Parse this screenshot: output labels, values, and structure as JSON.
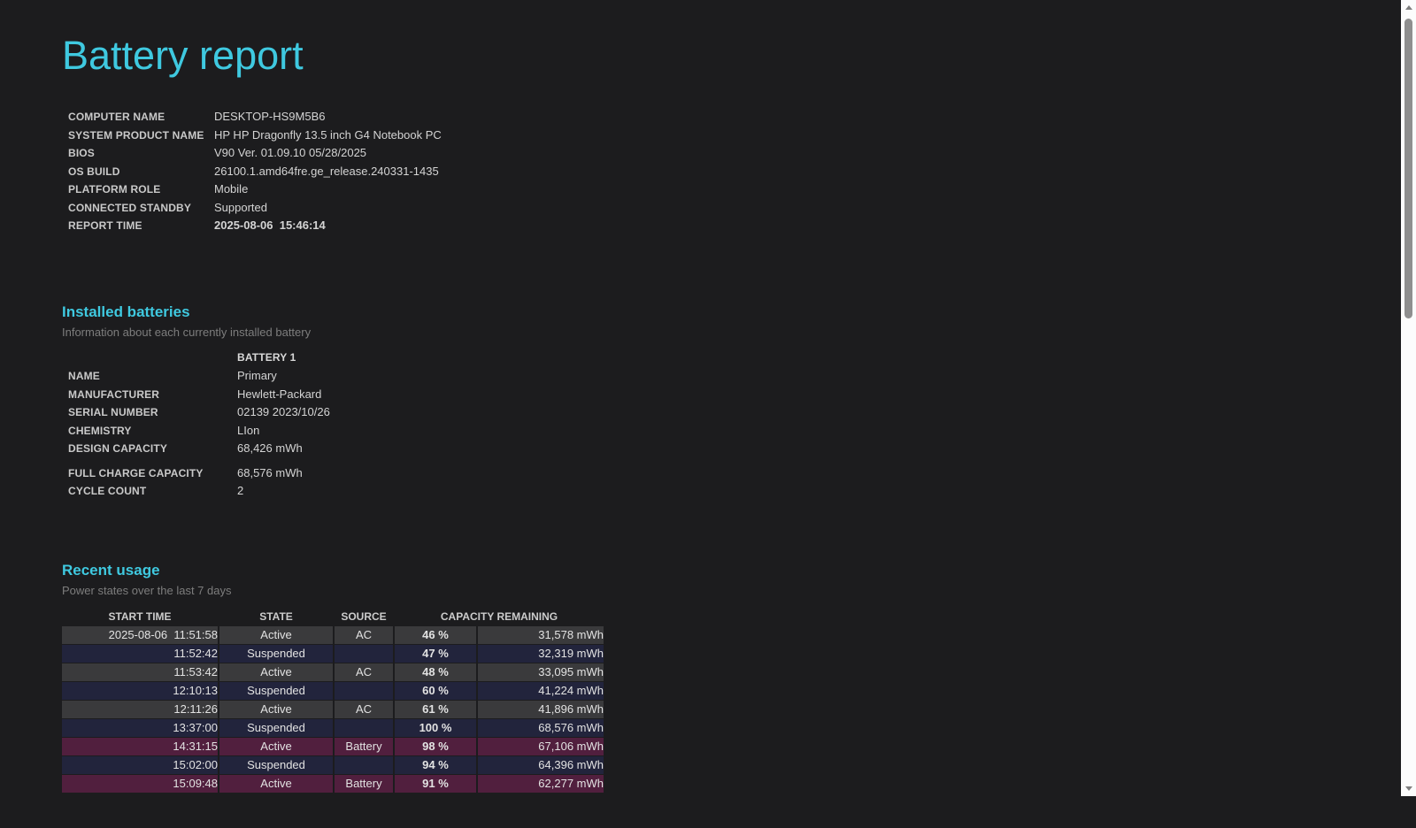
{
  "page": {
    "title": "Battery report",
    "background": "#1c1c1e",
    "accent": "#3fc9e0"
  },
  "system_info": {
    "rows": [
      {
        "label": "COMPUTER NAME",
        "value": "DESKTOP-HS9M5B6"
      },
      {
        "label": "SYSTEM PRODUCT NAME",
        "value": "HP HP Dragonfly 13.5 inch G4 Notebook PC"
      },
      {
        "label": "BIOS",
        "value": "V90 Ver. 01.09.10 05/28/2025"
      },
      {
        "label": "OS BUILD",
        "value": "26100.1.amd64fre.ge_release.240331-1435"
      },
      {
        "label": "PLATFORM ROLE",
        "value": "Mobile"
      },
      {
        "label": "CONNECTED STANDBY",
        "value": "Supported"
      },
      {
        "label": "REPORT TIME",
        "value": "2025-08-06  15:46:14",
        "bold": true
      }
    ]
  },
  "installed_batteries": {
    "heading": "Installed batteries",
    "subtitle": "Information about each currently installed battery",
    "column_header": "BATTERY 1",
    "rows": [
      {
        "label": "NAME",
        "value": "Primary"
      },
      {
        "label": "MANUFACTURER",
        "value": "Hewlett-Packard"
      },
      {
        "label": "SERIAL NUMBER",
        "value": "02139 2023/10/26"
      },
      {
        "label": "CHEMISTRY",
        "value": "LIon"
      },
      {
        "label": "DESIGN CAPACITY",
        "value": "68,426 mWh"
      },
      {
        "label": "FULL CHARGE CAPACITY",
        "value": "68,576 mWh",
        "gap_before": true
      },
      {
        "label": "CYCLE COUNT",
        "value": "2"
      }
    ]
  },
  "recent_usage": {
    "heading": "Recent usage",
    "subtitle": "Power states over the last 7 days",
    "columns": [
      "START TIME",
      "STATE",
      "SOURCE",
      "CAPACITY REMAINING"
    ],
    "row_colors": {
      "active-ac": "#3a3a3c",
      "suspended": "#22243c",
      "active-battery": "#511f3e"
    },
    "rows": [
      {
        "date": "2025-08-06",
        "time": "11:51:58",
        "state": "Active",
        "source": "AC",
        "percent": "46 %",
        "mwh": "31,578 mWh",
        "kind": "active-ac"
      },
      {
        "date": "",
        "time": "11:52:42",
        "state": "Suspended",
        "source": "",
        "percent": "47 %",
        "mwh": "32,319 mWh",
        "kind": "suspended"
      },
      {
        "date": "",
        "time": "11:53:42",
        "state": "Active",
        "source": "AC",
        "percent": "48 %",
        "mwh": "33,095 mWh",
        "kind": "active-ac"
      },
      {
        "date": "",
        "time": "12:10:13",
        "state": "Suspended",
        "source": "",
        "percent": "60 %",
        "mwh": "41,224 mWh",
        "kind": "suspended"
      },
      {
        "date": "",
        "time": "12:11:26",
        "state": "Active",
        "source": "AC",
        "percent": "61 %",
        "mwh": "41,896 mWh",
        "kind": "active-ac"
      },
      {
        "date": "",
        "time": "13:37:00",
        "state": "Suspended",
        "source": "",
        "percent": "100 %",
        "mwh": "68,576 mWh",
        "kind": "suspended"
      },
      {
        "date": "",
        "time": "14:31:15",
        "state": "Active",
        "source": "Battery",
        "percent": "98 %",
        "mwh": "67,106 mWh",
        "kind": "active-battery"
      },
      {
        "date": "",
        "time": "15:02:00",
        "state": "Suspended",
        "source": "",
        "percent": "94 %",
        "mwh": "64,396 mWh",
        "kind": "suspended"
      },
      {
        "date": "",
        "time": "15:09:48",
        "state": "Active",
        "source": "Battery",
        "percent": "91 %",
        "mwh": "62,277 mWh",
        "kind": "active-battery"
      }
    ]
  },
  "scrollbar": {
    "track_color": "#fcfcfc",
    "thumb_color": "#8f8f8f",
    "arrow_color": "#7f7f7f"
  }
}
